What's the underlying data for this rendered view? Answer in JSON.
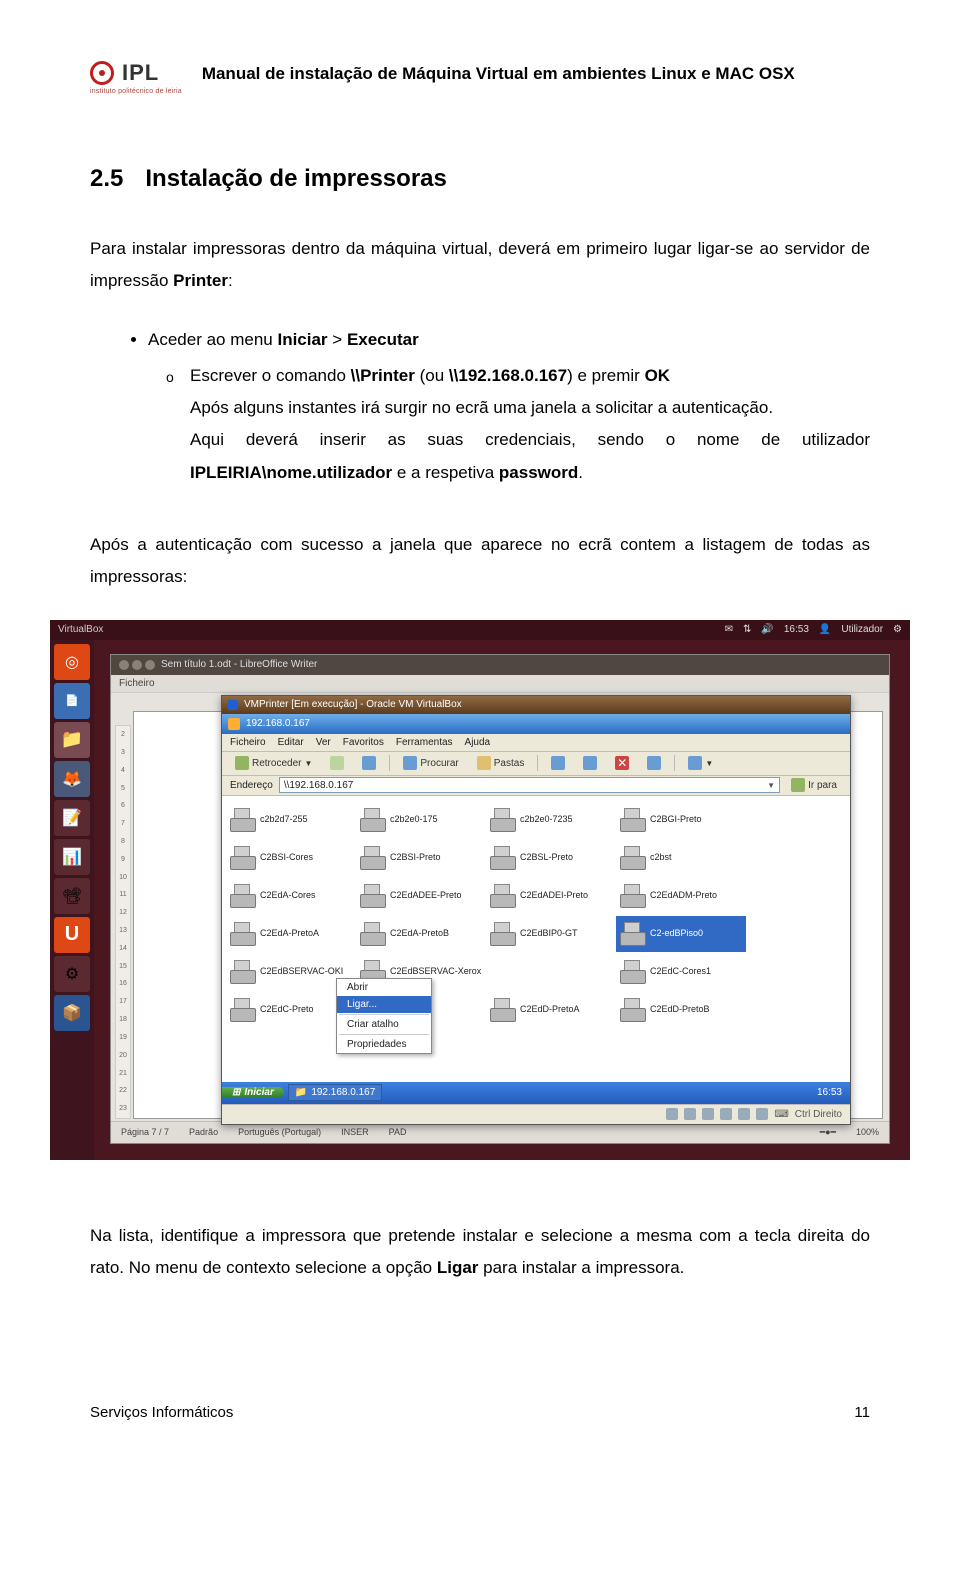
{
  "header": {
    "logo_text": "IPL",
    "logo_sub": "instituto politécnico de leiria",
    "title": "Manual de instalação de Máquina Virtual em ambientes Linux e MAC OSX"
  },
  "section": {
    "number": "2.5",
    "title": "Instalação de impressoras"
  },
  "p1_a": "Para instalar impressoras dentro da máquina virtual, deverá em primeiro lugar ligar-se ao servidor de impressão ",
  "p1_b": "Printer",
  "p1_c": ":",
  "b1_a": "Aceder ao menu ",
  "b1_b": "Iniciar",
  "b1_c": " > ",
  "b1_d": "Executar",
  "b2_a": "Escrever o comando ",
  "b2_b": "\\\\Printer",
  "b2_c": " (ou ",
  "b2_d": "\\\\192.168.0.167",
  "b2_e": ") e premir ",
  "b2_f": "OK",
  "b2_g": "Após alguns instantes irá surgir no ecrã uma janela a solicitar a autenticação.",
  "b2_h": "Aqui deverá inserir as suas credenciais, sendo o nome de utilizador ",
  "b2_i": "IPLEIRIA\\nome.utilizador",
  "b2_j": " e a respetiva ",
  "b2_k": "password",
  "b2_l": ".",
  "p2": "Após a autenticação com sucesso a janela que aparece no ecrã contem a listagem de todas as impressoras:",
  "p3_a": "Na lista, identifique a impressora que pretende instalar e selecione a mesma com a tecla direita do rato. No menu de contexto selecione a opção ",
  "p3_b": "Ligar",
  "p3_c": " para instalar a impressora.",
  "footer": {
    "left": "Serviços Informáticos",
    "right": "11"
  },
  "ubuntu": {
    "topbar_left": "VirtualBox",
    "topbar_time": "16:53",
    "topbar_user": "Utilizador",
    "desk_label": "Sem título 1.odt",
    "writer_title": "Sem título 1.odt - LibreOffice Writer",
    "writer_menu": "Ficheiro",
    "ruler": [
      "2",
      "3",
      "4",
      "5",
      "6",
      "7",
      "8",
      "9",
      "10",
      "11",
      "12",
      "13",
      "14",
      "15",
      "16",
      "17",
      "18",
      "19",
      "20",
      "21",
      "22",
      "23"
    ],
    "status": {
      "page": "Página 7 / 7",
      "style": "Padrão",
      "lang": "Português (Portugal)",
      "ins": "INSER",
      "pad": "PAD",
      "zoom": "100%"
    }
  },
  "vm": {
    "outer_title": "VMPrinter [Em execução] - Oracle VM VirtualBox",
    "xp_title": "192.168.0.167",
    "menu": [
      "Ficheiro",
      "Editar",
      "Ver",
      "Favoritos",
      "Ferramentas",
      "Ajuda"
    ],
    "toolbar": {
      "back": "Retroceder",
      "search": "Procurar",
      "folders": "Pastas"
    },
    "addr_label": "Endereço",
    "addr_value": "\\\\192.168.0.167",
    "go": "Ir para",
    "printers": [
      "c2b2d7-255",
      "c2b2e0-175",
      "c2b2e0-7235",
      "C2BGI-Preto",
      "C2BSI-Cores",
      "C2BSI-Preto",
      "C2BSL-Preto",
      "c2bst",
      "C2EdA-Cores",
      "C2EdADEE-Preto",
      "C2EdADEI-Preto",
      "C2EdADM-Preto",
      "C2EdA-PretoA",
      "C2EdA-PretoB",
      "C2EdBIP0-GT",
      "C2-edBPiso0",
      "C2EdBSERVAC-OKI",
      "C2EdBSERVAC-Xerox",
      "",
      "C2EdC-Cores1",
      "C2EdC-Preto",
      "",
      "C2EdD-PretoA",
      "C2EdD-PretoB"
    ],
    "selected_index": 15,
    "ctx": {
      "open": "Abrir",
      "connect": "Ligar...",
      "shortcut": "Criar atalho",
      "props": "Propriedades"
    },
    "taskbar": {
      "start": "Iniciar",
      "task": "192.168.0.167",
      "clock": "16:53"
    },
    "vm_status": "Ctrl Direito"
  }
}
